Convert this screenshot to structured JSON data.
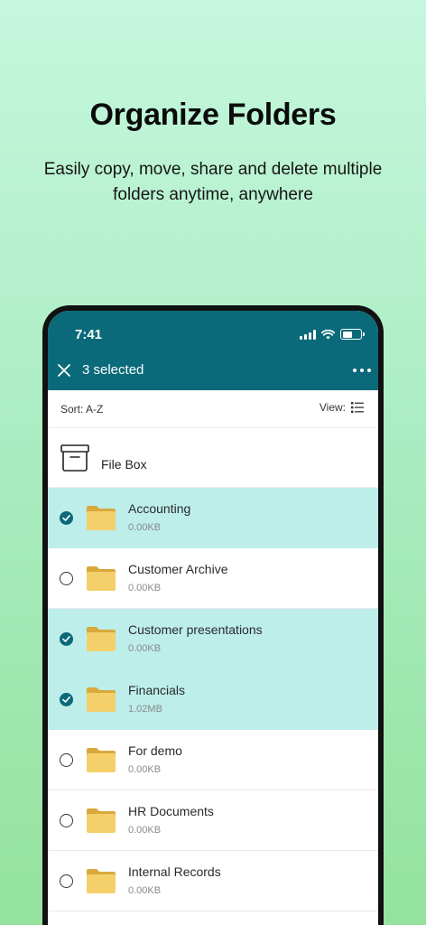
{
  "promo": {
    "headline": "Organize Folders",
    "subline": "Easily copy, move, share and delete multiple folders anytime, anywhere"
  },
  "status": {
    "time": "7:41"
  },
  "header": {
    "selected_label": "3 selected"
  },
  "toolbar": {
    "sort_label": "Sort: A-Z",
    "view_label": "View:"
  },
  "filebox": {
    "label": "File Box"
  },
  "folders": [
    {
      "name": "Accounting",
      "size": "0.00KB",
      "selected": true
    },
    {
      "name": "Customer Archive",
      "size": "0.00KB",
      "selected": false
    },
    {
      "name": "Customer presentations",
      "size": "0.00KB",
      "selected": true
    },
    {
      "name": "Financials",
      "size": "1.02MB",
      "selected": true
    },
    {
      "name": "For demo",
      "size": "0.00KB",
      "selected": false
    },
    {
      "name": "HR Documents",
      "size": "0.00KB",
      "selected": false
    },
    {
      "name": "Internal Records",
      "size": "0.00KB",
      "selected": false
    }
  ],
  "colors": {
    "primary": "#0b6a7a",
    "selected_row": "#bdeeea",
    "folder": "#f4cf6a",
    "folder_tab": "#d9a93c"
  }
}
